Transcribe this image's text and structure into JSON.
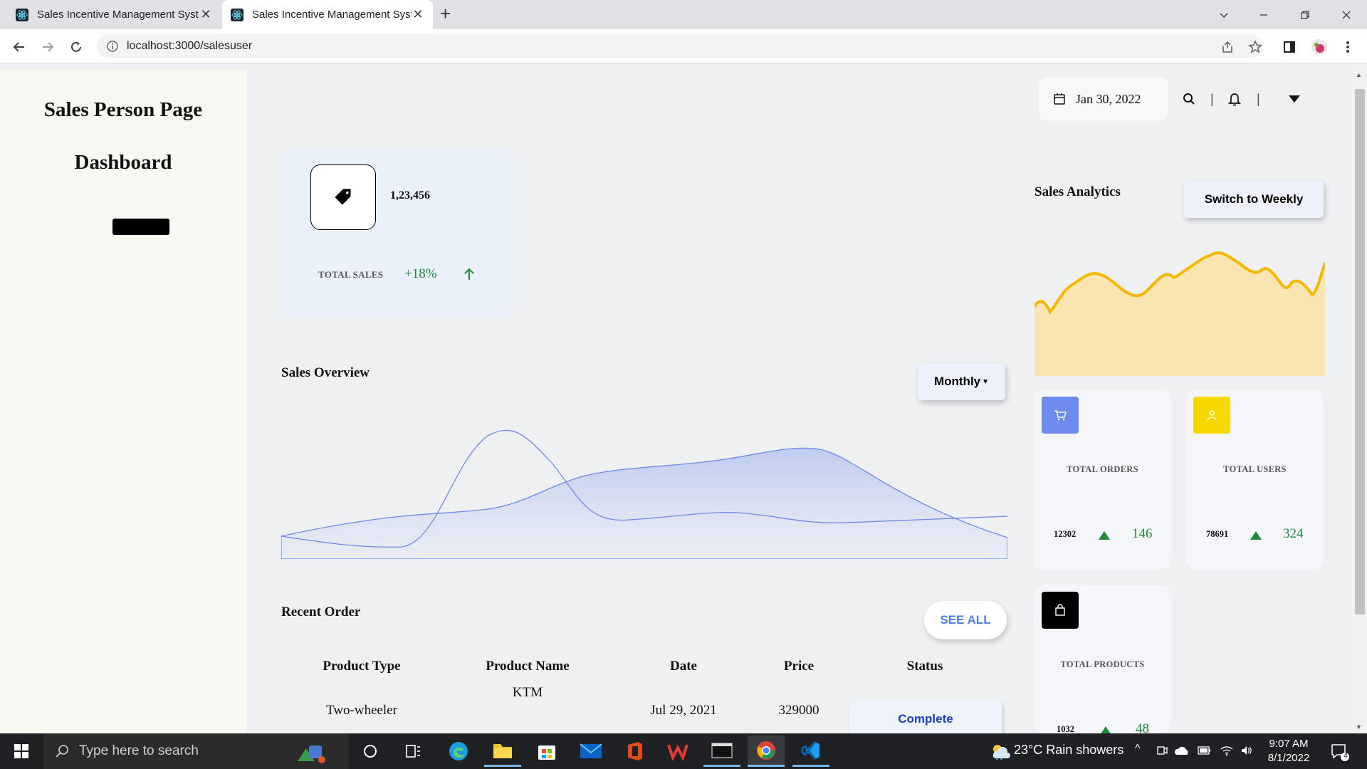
{
  "browser": {
    "tabs": [
      {
        "title": "Sales Incentive Management Syst"
      },
      {
        "title": "Sales Incentive Management Syst"
      }
    ],
    "url": "localhost:3000/salesuser"
  },
  "sidebar": {
    "title": "Sales Person Page",
    "subtitle": "Dashboard"
  },
  "header": {
    "date": "Jan 30, 2022"
  },
  "total_sales_card": {
    "value": "1,23,456",
    "label": "TOTAL SALES",
    "change": "+18%"
  },
  "sales_overview": {
    "title": "Sales Overview",
    "period_button": "Monthly"
  },
  "recent_order": {
    "title": "Recent Order",
    "see_all": "SEE ALL",
    "columns": [
      "Product Type",
      "Product Name",
      "Date",
      "Price",
      "Status"
    ],
    "rows": [
      {
        "type": "Two-wheeler",
        "name": "KTM",
        "date": "Jul 29, 2021",
        "price": "329000",
        "status": "Complete"
      }
    ]
  },
  "sales_analytics": {
    "title": "Sales Analytics",
    "switch_button": "Switch to Weekly"
  },
  "stats": {
    "orders": {
      "label": "TOTAL ORDERS",
      "count": "12302",
      "delta": "146"
    },
    "users": {
      "label": "TOTAL USERS",
      "count": "78691",
      "delta": "324"
    },
    "products": {
      "label": "TOTAL PRODUCTS",
      "count": "1032",
      "delta": "48"
    }
  },
  "colors": {
    "accent_blue": "#6e8cf0",
    "accent_yellow": "#f5d800",
    "positive": "#1d8a3a",
    "analytics_line": "#f5b800",
    "analytics_fill": "#f8e5b0"
  },
  "taskbar": {
    "search_placeholder": "Type here to search",
    "weather": "23°C  Rain showers",
    "time": "9:07 AM",
    "date": "8/1/2022",
    "notifications": "4"
  }
}
